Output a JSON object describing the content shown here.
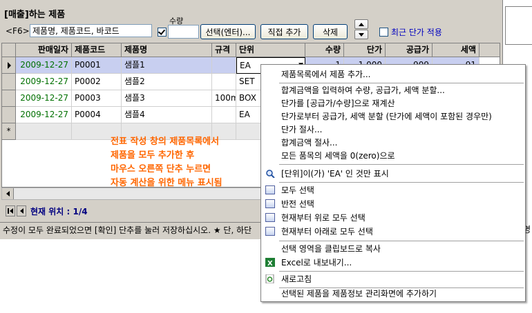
{
  "header": {
    "title": "[매출]하는 제품",
    "f6_label": "<F6>",
    "search_value": "제품명, 제품코드, 바코드",
    "qty_label": "수량",
    "select_button": "선택(엔터)...",
    "direct_add_button": "직접 추가",
    "delete_button": "삭제",
    "recent_price_label": "최근 단가 적용"
  },
  "grid": {
    "columns": [
      "판매일자",
      "제품코드",
      "제품명",
      "규격",
      "단위",
      "수량",
      "단가",
      "공급가",
      "세액"
    ],
    "rows": [
      {
        "date": "2009-12-27",
        "code": "P0001",
        "name": "샘플1",
        "spec": "",
        "unit": "EA",
        "qty": "1",
        "price": "1,000",
        "supply": "909",
        "tax": "91"
      },
      {
        "date": "2009-12-27",
        "code": "P0002",
        "name": "샘플2",
        "spec": "",
        "unit": "SET",
        "qty": "",
        "price": "",
        "supply": "",
        "tax": ""
      },
      {
        "date": "2009-12-27",
        "code": "P0003",
        "name": "샘플3",
        "spec": "100m",
        "unit": "BOX",
        "qty": "",
        "price": "",
        "supply": "",
        "tax": ""
      },
      {
        "date": "2009-12-27",
        "code": "P0004",
        "name": "샘플4",
        "spec": "",
        "unit": "EA",
        "qty": "",
        "price": "",
        "supply": "",
        "tax": ""
      }
    ],
    "new_row_marker": "*"
  },
  "annotation": {
    "line1": "전표 작성 창의 제품목록에서",
    "line2": "제품을 모두 추가한 후",
    "line3": "마우스 오른쪽 단추 누르면",
    "line4": "자동 계산을 위한 메뉴 표시됨"
  },
  "navigator": {
    "position_label": "현재 위치 : 1/4"
  },
  "status_bar": {
    "text": "수정이 모두 완료되었으면 [확인] 단추를 눌러 저장하십시오. ★ 단, 하단"
  },
  "right_edge": {
    "text": "명"
  },
  "context_menu": {
    "items": [
      "제품목록에서 제품 추가...",
      "합계금액을 입력하여 수량, 공급가, 세액 분할...",
      "단가를 [공급가/수량]으로 재계산",
      "단가로부터 공급가, 세액 분할 (단가에 세액이 포함된 경우만)",
      "단가 절사...",
      "합계금액 절사...",
      "모든 품목의 세액을 0(zero)으로",
      "[단위]이(가) 'EA' 인 것만 표시",
      "모두 선택",
      "반전 선택",
      "현재부터 위로 모두 선택",
      "현재부터 아래로 모두 선택",
      "선택 영역을 클립보드로 복사",
      "Excel로 내보내기...",
      "새로고침",
      "선택된 제품을 제품정보 관리화면에 추가하기"
    ]
  }
}
